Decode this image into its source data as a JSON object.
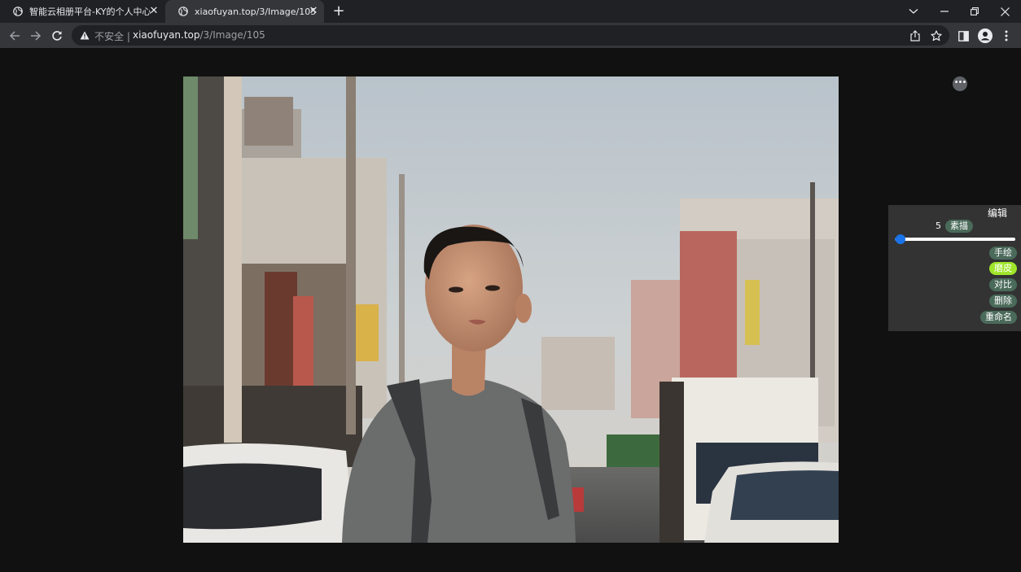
{
  "browser": {
    "tabs": [
      {
        "title": "智能云相册平台-KY的个人中心",
        "active": false
      },
      {
        "title": "xiaofuyan.top/3/Image/105",
        "active": true
      }
    ],
    "address": {
      "security_label": "不安全",
      "separator": "|",
      "host": "xiaofuyan.top",
      "path": "/3/Image/105"
    }
  },
  "editor": {
    "title": "编辑",
    "slider_value": 5,
    "slider_min": 0,
    "slider_max": 100,
    "effect_label": "素描",
    "actions": [
      {
        "label": "手绘",
        "active": false
      },
      {
        "label": "磨皮",
        "active": true
      },
      {
        "label": "对比",
        "active": false
      },
      {
        "label": "删除",
        "active": false
      },
      {
        "label": "重命名",
        "active": false
      }
    ],
    "more_label": "•••"
  },
  "colors": {
    "active_pill": "#9fe62a",
    "pill": "#4a6a5a",
    "slider": "#1a73e8",
    "page_bg": "#111111"
  }
}
